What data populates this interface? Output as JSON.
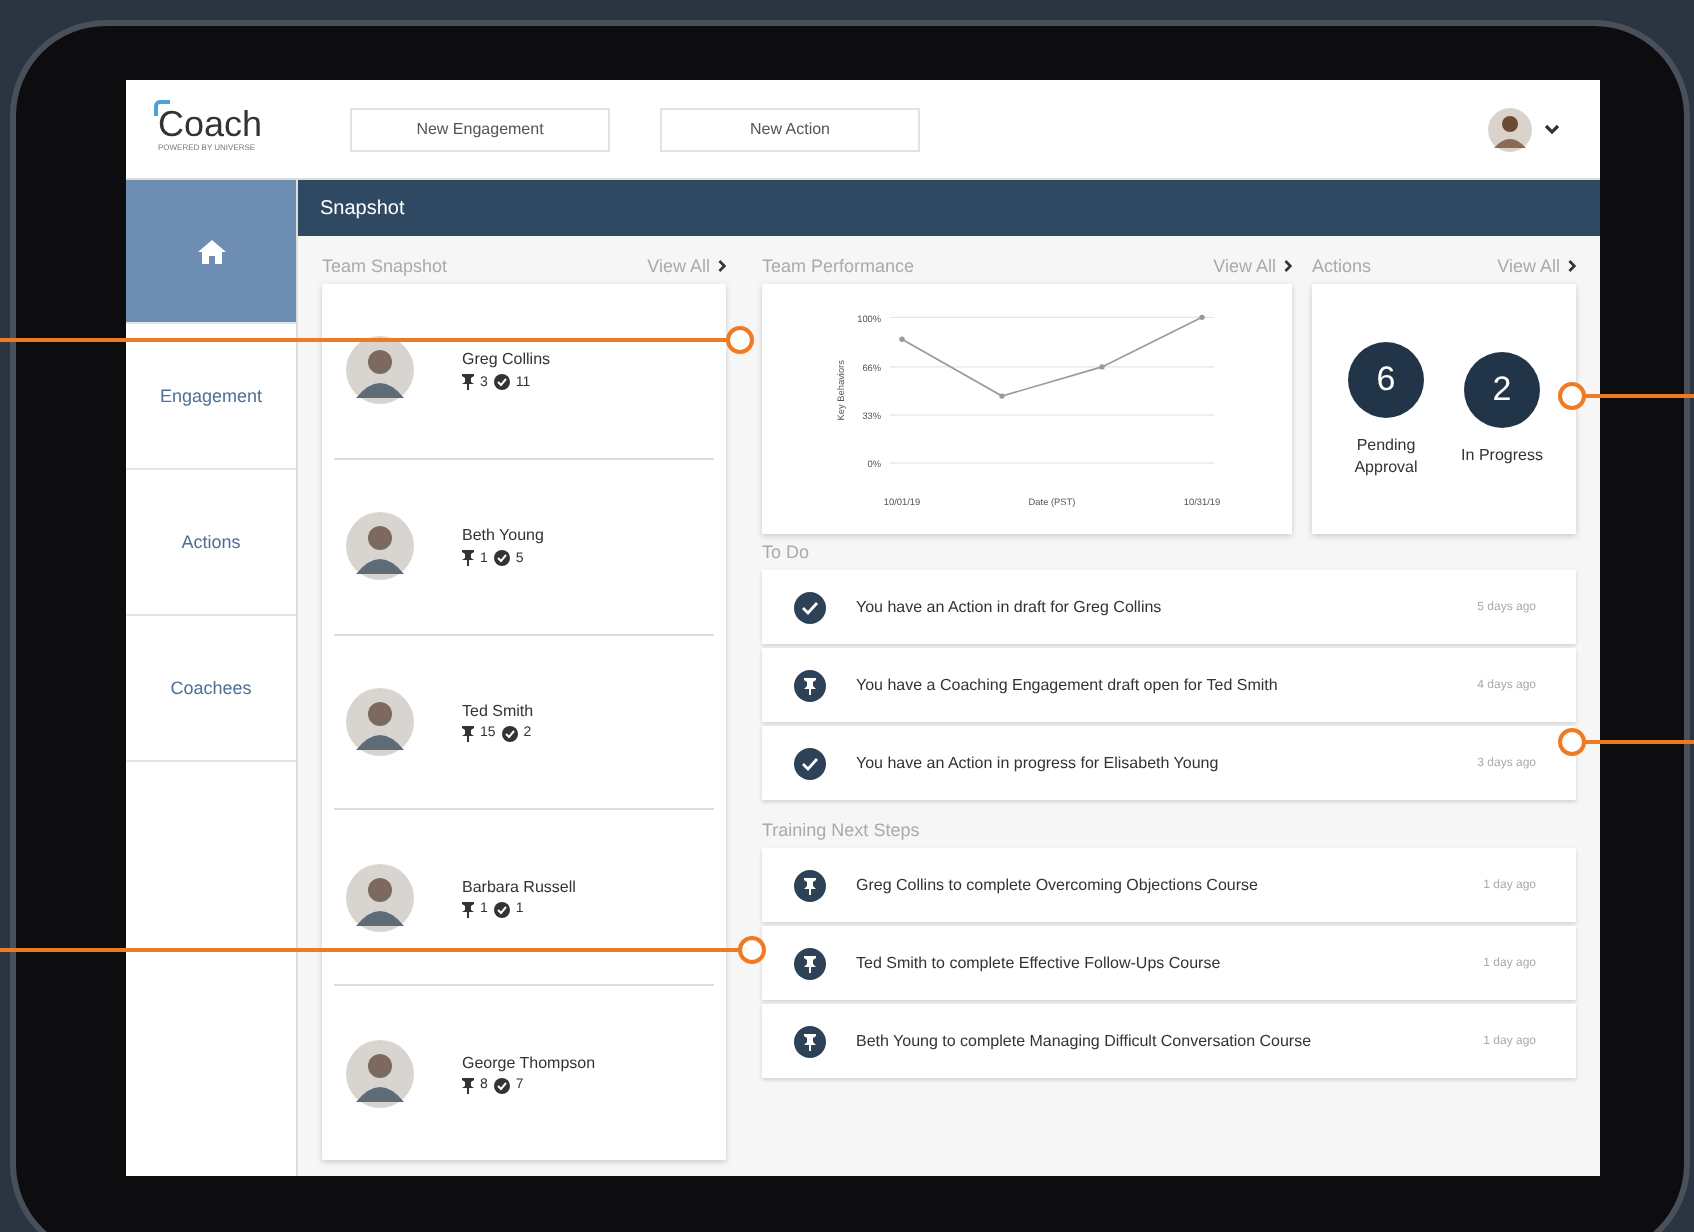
{
  "header": {
    "logo": "Coach",
    "logo_tagline": "POWERED BY UNIVERSE",
    "buttons": [
      "New Engagement",
      "New Action"
    ]
  },
  "sidebar": {
    "items": [
      {
        "kind": "home",
        "selected": true
      },
      {
        "kind": "text",
        "label": "Engagement",
        "selected": false
      },
      {
        "kind": "text",
        "label": "Actions",
        "selected": false
      },
      {
        "kind": "text",
        "label": "Coachees",
        "selected": false
      }
    ]
  },
  "page_title": "Snapshot",
  "team_snapshot": {
    "title": "Team Snapshot",
    "view_all": "View All",
    "people": [
      {
        "name": "Greg Collins",
        "engagements": "3",
        "actions": "11"
      },
      {
        "name": "Beth Young",
        "engagements": "1",
        "actions": "5"
      },
      {
        "name": "Ted Smith",
        "engagements": "15",
        "actions": "2"
      },
      {
        "name": "Barbara Russell",
        "engagements": "1",
        "actions": "1"
      },
      {
        "name": "George Thompson",
        "engagements": "8",
        "actions": "7"
      }
    ]
  },
  "team_performance": {
    "title": "Team Performance",
    "view_all": "View All",
    "chart_data": {
      "type": "line",
      "xlabel": "Date (PST)",
      "ylabel": "Key Behaviors",
      "categories": [
        "10/01/19",
        null,
        null,
        "10/31/19"
      ],
      "ylim": [
        0,
        100
      ],
      "yticks": [
        {
          "value": 0,
          "label": "0%"
        },
        {
          "value": 33,
          "label": "33%"
        },
        {
          "value": 66,
          "label": "66%"
        },
        {
          "value": 100,
          "label": "100%"
        }
      ],
      "values": [
        85,
        46,
        66,
        100
      ]
    }
  },
  "actions": {
    "title": "Actions",
    "view_all": "View All",
    "stats": [
      {
        "value": "6",
        "label": "Pending Approval"
      },
      {
        "value": "2",
        "label": "In Progress"
      }
    ]
  },
  "todo": {
    "title": "To Do",
    "items": [
      {
        "kind": "check",
        "text": "You have an Action in draft for Greg Collins",
        "time": "5 days ago"
      },
      {
        "kind": "pin",
        "text": "You have a Coaching Engagement draft open for Ted Smith",
        "time": "4 days ago"
      },
      {
        "kind": "check",
        "text": "You have an Action in progress for Elisabeth Young",
        "time": "3 days ago"
      }
    ]
  },
  "training": {
    "title": "Training Next Steps",
    "items": [
      {
        "kind": "pin",
        "text": "Greg Collins to complete Overcoming Objections Course",
        "time": "1 day ago"
      },
      {
        "kind": "pin",
        "text": "Ted Smith to complete Effective Follow-Ups Course",
        "time": "1 day ago"
      },
      {
        "kind": "pin",
        "text": "Beth Young to complete Managing Difficult Conversation Course",
        "time": "1 day ago"
      }
    ]
  }
}
